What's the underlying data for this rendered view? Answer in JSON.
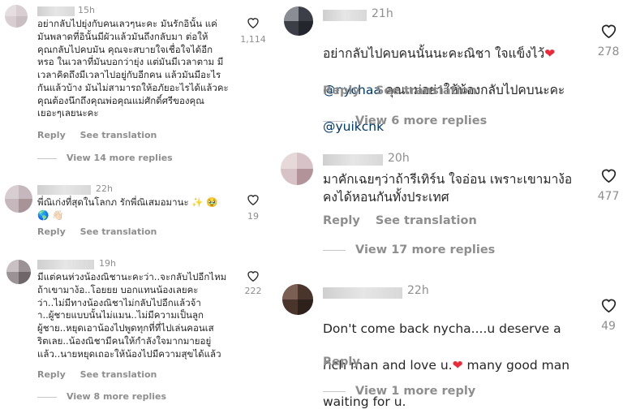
{
  "colors": {
    "muted": "#8e8e8e",
    "text": "#262626",
    "mention": "#00376b",
    "heart_red": "#ed2939"
  },
  "left": {
    "c1": {
      "time": "15h",
      "text": "อย่ากลับไปยุ่งกับคนเลวๆนะคะ มันรักอินั้น แค่\nมันพลาดที่อินั้นมีผัวแล้วมันถึงกลับมา  ต่อให้\nคุณกลับไปคบมัน คุณจะสบายใจเชื่อใจได้อีก\nหรอ ในเวลาที่มันบอกว่ายุ่ง แต่มันมีเวลาตาม มี\nเวลาคิดถึงมีเวลาไปอยู่กับอีกคน แล้วมันมีอะไร\nกันแล้วบ้าง มันไม่สามารถให้อภัยอะไรได้แล้วคะ\nคุณต้องนึกถึงคุณพ่อคุณแม่ศักดิ์ศรีของคุณ\nเยอะๆเลยนะคะ",
      "likes": "1,114",
      "reply": "Reply",
      "translate": "See translation",
      "more": "View 14 more replies"
    },
    "c2": {
      "time": "22h",
      "text": "พี่ณิเก่งที่สุดในโลกภ รักพี่ณิเสมอมานะ ✨ 🥹\n🌎 👋🏻",
      "likes": "19",
      "reply": "Reply",
      "translate": "See translation"
    },
    "c3": {
      "time": "19h",
      "text": "มีแต่คนห่วงน้องณิชานะคะว่า..จะกลับไปอีกไหม\nถ้าเขามาง้อ..โอยยย บอกแทนน้องเลยคะ\nว่า..ไม่มีทางน้องณิชาไม่กลับไปอีกแล้วจ้า\nา..ผู้ชายแบบนั้นไม่แมน..ไม่มีความเป็นลูก\nผู้ชาย..หยุดเอาน้องไปพูดทุกที่ที่ไปเล่นคอนเส\nริตเลย..น้องณิชามีคนให้กำลังใจมากมายอยู่\nแล้ว..นายหยุดเถอะให้น้องไปมีความสุขได้แล้ว",
      "likes": "222",
      "reply": "Reply",
      "translate": "See translation",
      "more": "View 8 more replies"
    }
  },
  "right": {
    "c1": {
      "time": "21h",
      "text_prefix": "อย่ากลับไปคบคนนั้นนะคะณิชา ใจแข็งไว้",
      "mention1": "@nychaa",
      "text_mid": "  คุณแม่อย่าให้น้องกลับไปคบนะคะ",
      "mention2": "@yuikchk",
      "likes": "278",
      "reply": "Reply",
      "translate": "See translation",
      "more": "View 6 more replies"
    },
    "c2": {
      "time": "20h",
      "text": "มาคักเฉยๆว่าถ้ารีเทิร์น ใจอ่อน เพราะเขามาง้อ\nคงได้หอนกันทั้งประเทศ",
      "likes": "477",
      "reply": "Reply",
      "translate": "See translation",
      "more": "View 17 more replies"
    },
    "c3": {
      "time": "22h",
      "text_line1": "Don't come back nycha....u deserve a",
      "text_line2_prefix": "rich man and love u.",
      "text_line2_suffix": " many good man",
      "text_line3": "waiting for u.",
      "likes": "49",
      "reply": "Reply",
      "more": "View 1 more reply"
    }
  },
  "icons": {
    "heart": "heart-outline-icon",
    "heart_emoji": "red-heart-emoji-icon"
  }
}
